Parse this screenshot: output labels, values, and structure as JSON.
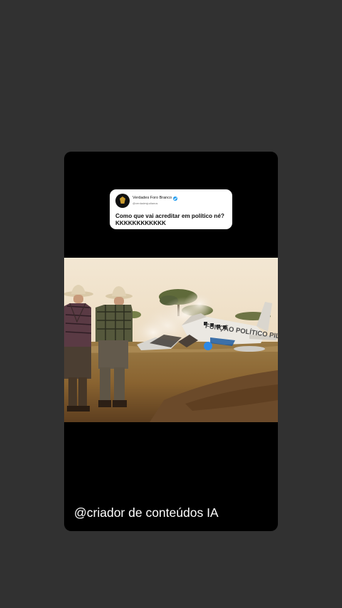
{
  "tweet": {
    "author_name": "Verdades Foro Branco",
    "author_handle": "@verdadesjudianus",
    "text": "Como que vai acreditar em político né?\nKKKKKKKKKKKK"
  },
  "photo": {
    "plane_text": "FUNÇÃO POLÍTICO PIL"
  },
  "caption": "@criador de conteúdos IA"
}
